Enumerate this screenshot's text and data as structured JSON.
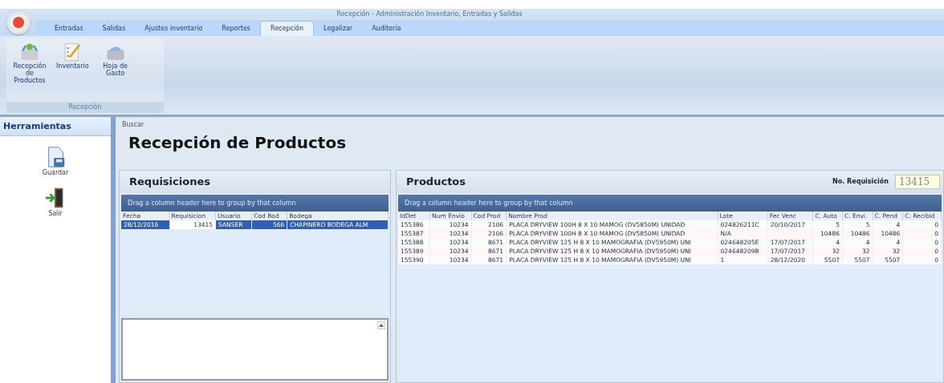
{
  "window": {
    "title": "Recepción - Administración Inventario, Entradas y Salidas"
  },
  "tabs": [
    {
      "label": "Entradas",
      "selected": false
    },
    {
      "label": "Salidas",
      "selected": false
    },
    {
      "label": "Ajustes inventario",
      "selected": false
    },
    {
      "label": "Reportes",
      "selected": false
    },
    {
      "label": "Recepción",
      "selected": true
    },
    {
      "label": "Legalizar",
      "selected": false
    },
    {
      "label": "Auditoria",
      "selected": false
    }
  ],
  "ribbon": {
    "group": "Recepción",
    "buttons": [
      {
        "label": "Recepción de Productos",
        "kind": "basket-in"
      },
      {
        "label": "Inventario",
        "kind": "checklist"
      },
      {
        "label": "Hoja de Gasto",
        "kind": "basket"
      }
    ]
  },
  "sidebar": {
    "title": "Herramientas",
    "items": [
      {
        "label": "Guardar",
        "kind": "save"
      },
      {
        "label": "Salir",
        "kind": "exit"
      }
    ]
  },
  "breadcrumb": "Buscar",
  "page_title": "Recepción de Productos",
  "requisiciones": {
    "title": "Requisiciones",
    "group_hint": "Drag a column header here to group by that column",
    "columns": [
      "Fecha",
      "Requisicion",
      "Usuario",
      "Cod Bod",
      "Bodega"
    ],
    "rows": [
      {
        "cells": [
          "28/12/2016",
          "13415",
          "SANSER",
          "566",
          "CHAPINERO BODEGA ALM"
        ],
        "selected": true
      }
    ]
  },
  "productos": {
    "title": "Productos",
    "req_label": "No. Requisición",
    "req_value": "13415",
    "group_hint": "Drag a column header here to group by that column",
    "columns": [
      "IdDet",
      "Num Envio",
      "Cod Prod",
      "Nombre Prod",
      "Lote",
      "Fec Venc",
      "C. Auto",
      "C. Envi.",
      "C. Pend",
      "C. Recibid"
    ],
    "rows": [
      [
        "155386",
        "10234",
        "2106",
        "PLACA DRYVIEW 100H 8 X 10 MAMOG (DV5850M) UNIDAD",
        "024826211C",
        "20/10/2017",
        "5",
        "5",
        "4",
        "0"
      ],
      [
        "155387",
        "10234",
        "2106",
        "PLACA DRYVIEW 100H 8 X 10 MAMOG (DV5850M) UNIDAD",
        "N/A",
        "",
        "10486",
        "10486",
        "10486",
        "0"
      ],
      [
        "155388",
        "10234",
        "8671",
        "PLACA DRYVIEW 125 H 8 X 10 MAMOGRAFIA (DV5950M) UNI",
        "024648205E",
        "17/07/2017",
        "4",
        "4",
        "4",
        "0"
      ],
      [
        "155389",
        "10234",
        "8671",
        "PLACA DRYVIEW 125 H 8 X 10 MAMOGRAFIA (DV5950M) UNI",
        "024648209B",
        "17/07/2017",
        "32",
        "32",
        "32",
        "0"
      ],
      [
        "155390",
        "10234",
        "8671",
        "PLACA DRYVIEW 125 H 8 X 10 MAMOGRAFIA (DV5950M) UNI",
        "1",
        "28/12/2020",
        "5507",
        "5507",
        "5507",
        "0"
      ]
    ]
  }
}
